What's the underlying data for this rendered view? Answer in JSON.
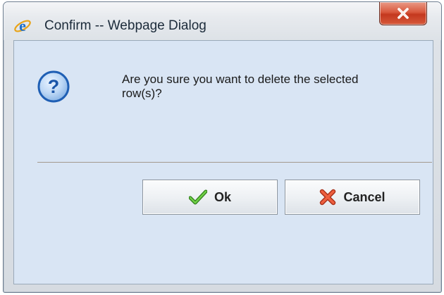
{
  "window": {
    "title": "Confirm -- Webpage Dialog",
    "app_icon": "internet-explorer-icon",
    "close_icon": "close-icon"
  },
  "dialog": {
    "icon": "question-icon",
    "message": "Are you sure you want to delete the selected row(s)?"
  },
  "buttons": {
    "ok_label": "Ok",
    "ok_icon": "checkmark-icon",
    "cancel_label": "Cancel",
    "cancel_icon": "x-mark-icon"
  },
  "colors": {
    "client_background": "#d9e5f4",
    "close_button": "#c4381e",
    "question_icon": "#1f5fb4",
    "ok_check": "#4aa82e",
    "cancel_x": "#e2492b"
  }
}
